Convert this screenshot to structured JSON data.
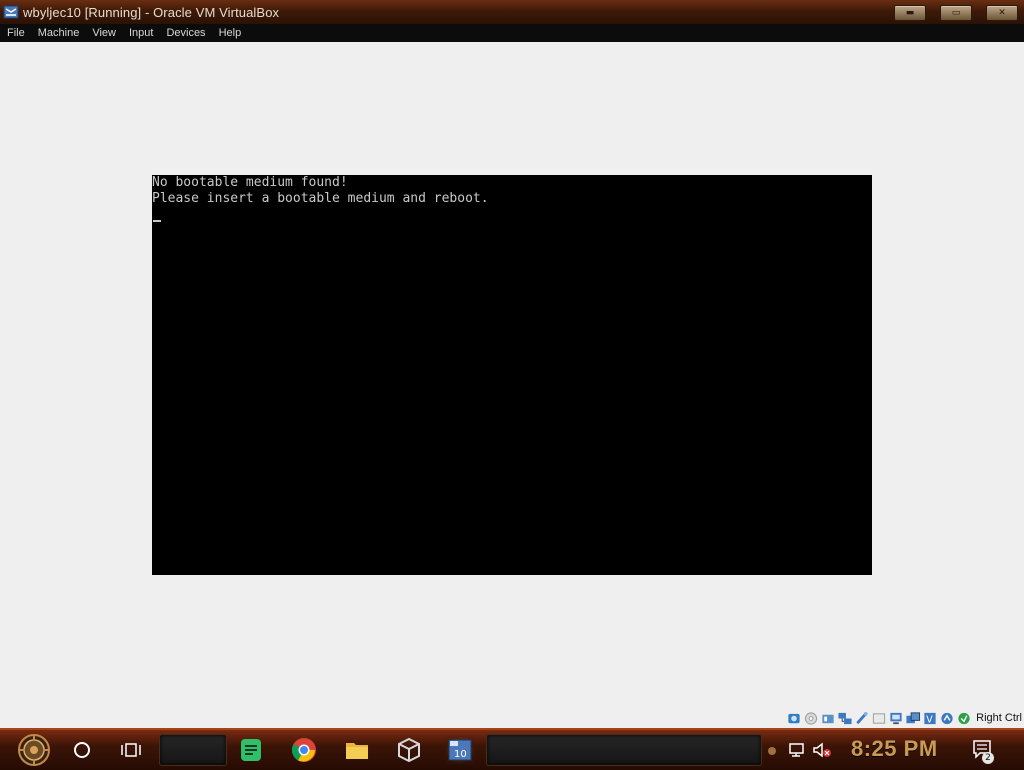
{
  "window": {
    "title": "wbyljec10 [Running] - Oracle VM VirtualBox",
    "app_icon": "virtualbox-icon",
    "controls": [
      "minimize",
      "maximize",
      "close"
    ]
  },
  "menubar": {
    "items": [
      "File",
      "Machine",
      "View",
      "Input",
      "Devices",
      "Help"
    ]
  },
  "console": {
    "lines": [
      "No bootable medium found!",
      "Please insert a bootable medium and reboot."
    ],
    "cursor": "_"
  },
  "statusbar": {
    "icons": [
      "hard-disk-icon",
      "optical-drive-icon",
      "audio-icon",
      "network-icon",
      "usb-icon",
      "shared-folders-icon",
      "display-icon",
      "video-capture-icon",
      "virtualization-icon",
      "mouse-integration-icon",
      "keyboard-icon"
    ],
    "host_key_label": "Right Ctrl"
  },
  "taskbar": {
    "clock": "8:25 PM",
    "notification_count": "2",
    "apps": [
      "notes-app-icon",
      "chrome-icon",
      "file-explorer-icon",
      "virtualbox-taskbar-icon",
      "vm-window-icon"
    ]
  },
  "colors": {
    "titlebar": "#3e1a08",
    "taskbar": "#3b1407",
    "clock": "#c89b54",
    "vm_screen": "#000000",
    "console_text": "#c8c8c8"
  }
}
